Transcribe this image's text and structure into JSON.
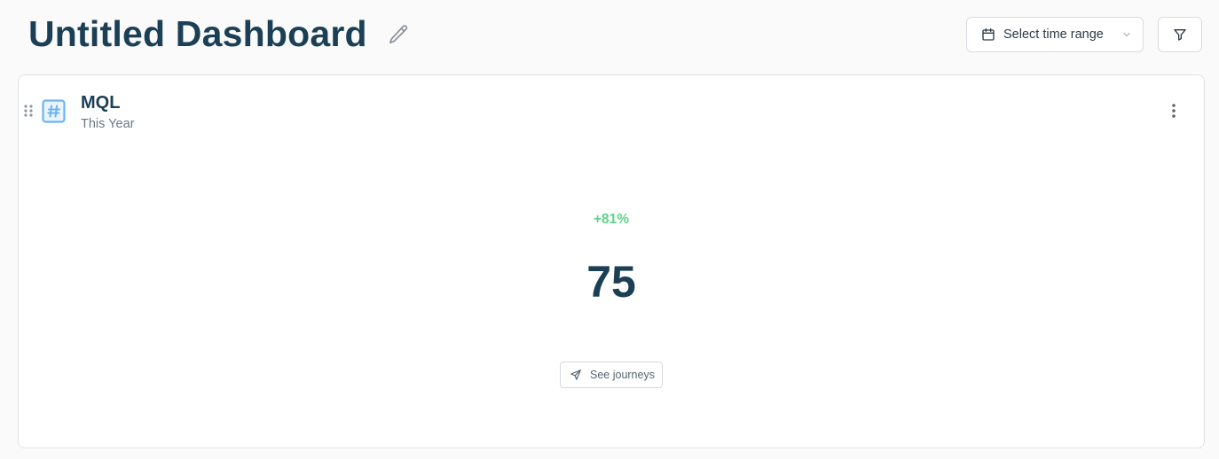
{
  "header": {
    "title": "Untitled Dashboard",
    "edit_icon": "pencil-icon",
    "time_range": {
      "label": "Select time range",
      "icon": "calendar-icon",
      "dropdown_icon": "chevron-down-icon"
    },
    "filter_icon": "filter-icon"
  },
  "card": {
    "type_icon": "hash-icon",
    "title": "MQL",
    "subtitle": "This Year",
    "change": "+81%",
    "value": "75",
    "journeys_button": {
      "label": "See journeys",
      "icon": "send-icon"
    },
    "menu_icon": "more-vertical-icon",
    "drag_icon": "drag-handle-icon"
  },
  "colors": {
    "title": "#1b3f55",
    "positive": "#5fd38b",
    "accent": "#6cb4f0",
    "border": "#dadde1"
  }
}
